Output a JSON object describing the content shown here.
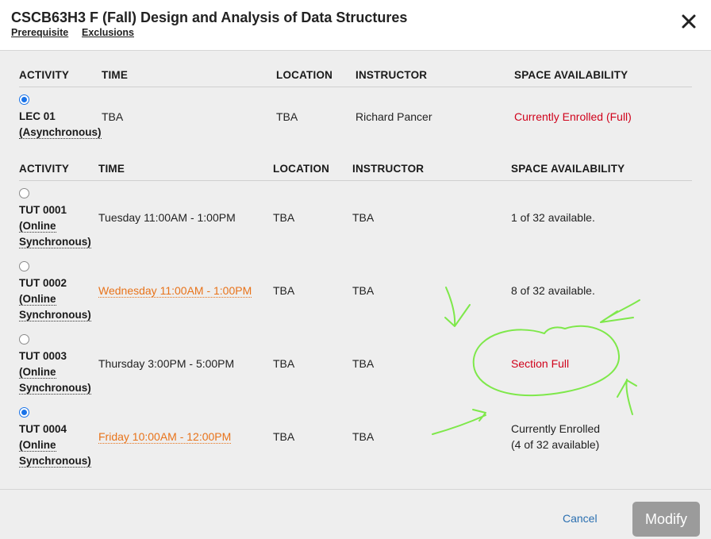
{
  "dialog": {
    "title": "CSCB63H3 F (Fall) Design and Analysis of Data Structures",
    "prerequisite_link": "Prerequisite",
    "exclusions_link": "Exclusions",
    "close_glyph": "✕"
  },
  "lecture_table": {
    "headers": [
      "ACTIVITY",
      "TIME",
      "LOCATION",
      "INSTRUCTOR",
      "SPACE AVAILABILITY"
    ],
    "rows": [
      {
        "selected": true,
        "code": "LEC 01",
        "mode": "(Asynchronous)",
        "time": "TBA",
        "location": "TBA",
        "instructor": "Richard Pancer",
        "availability": "Currently Enrolled (Full)"
      }
    ]
  },
  "tutorial_table": {
    "headers": [
      "ACTIVITY",
      "TIME",
      "LOCATION",
      "INSTRUCTOR",
      "SPACE AVAILABILITY"
    ],
    "rows": [
      {
        "selected": false,
        "code": "TUT 0001",
        "mode_1": "(Online",
        "mode_2": "Synchronous)",
        "time": "Tuesday 11:00AM - 1:00PM",
        "location": "TBA",
        "instructor": "TBA",
        "availability": "1 of 32 available."
      },
      {
        "selected": false,
        "code": "TUT 0002",
        "mode_1": "(Online",
        "mode_2": "Synchronous)",
        "time": "Wednesday 11:00AM - 1:00PM",
        "location": "TBA",
        "instructor": "TBA",
        "availability": "8 of 32 available."
      },
      {
        "selected": false,
        "code": "TUT 0003",
        "mode_1": "(Online",
        "mode_2": "Synchronous)",
        "time": "Thursday 3:00PM - 5:00PM",
        "location": "TBA",
        "instructor": "TBA",
        "availability": "Section Full"
      },
      {
        "selected": true,
        "code": "TUT 0004",
        "mode_1": "(Online",
        "mode_2": "Synchronous)",
        "time": "Friday 10:00AM - 12:00PM",
        "location": "TBA",
        "instructor": "TBA",
        "availability_1": "Currently Enrolled",
        "availability_2": "(4 of 32 available)"
      }
    ]
  },
  "footer": {
    "cancel_label": "Cancel",
    "modify_label": "Modify"
  },
  "colors": {
    "conflict_time": "#e8731a",
    "full_status": "#d0021b",
    "annotation_scribble": "#7ee84a",
    "radio_selected": "#1a73e8"
  }
}
